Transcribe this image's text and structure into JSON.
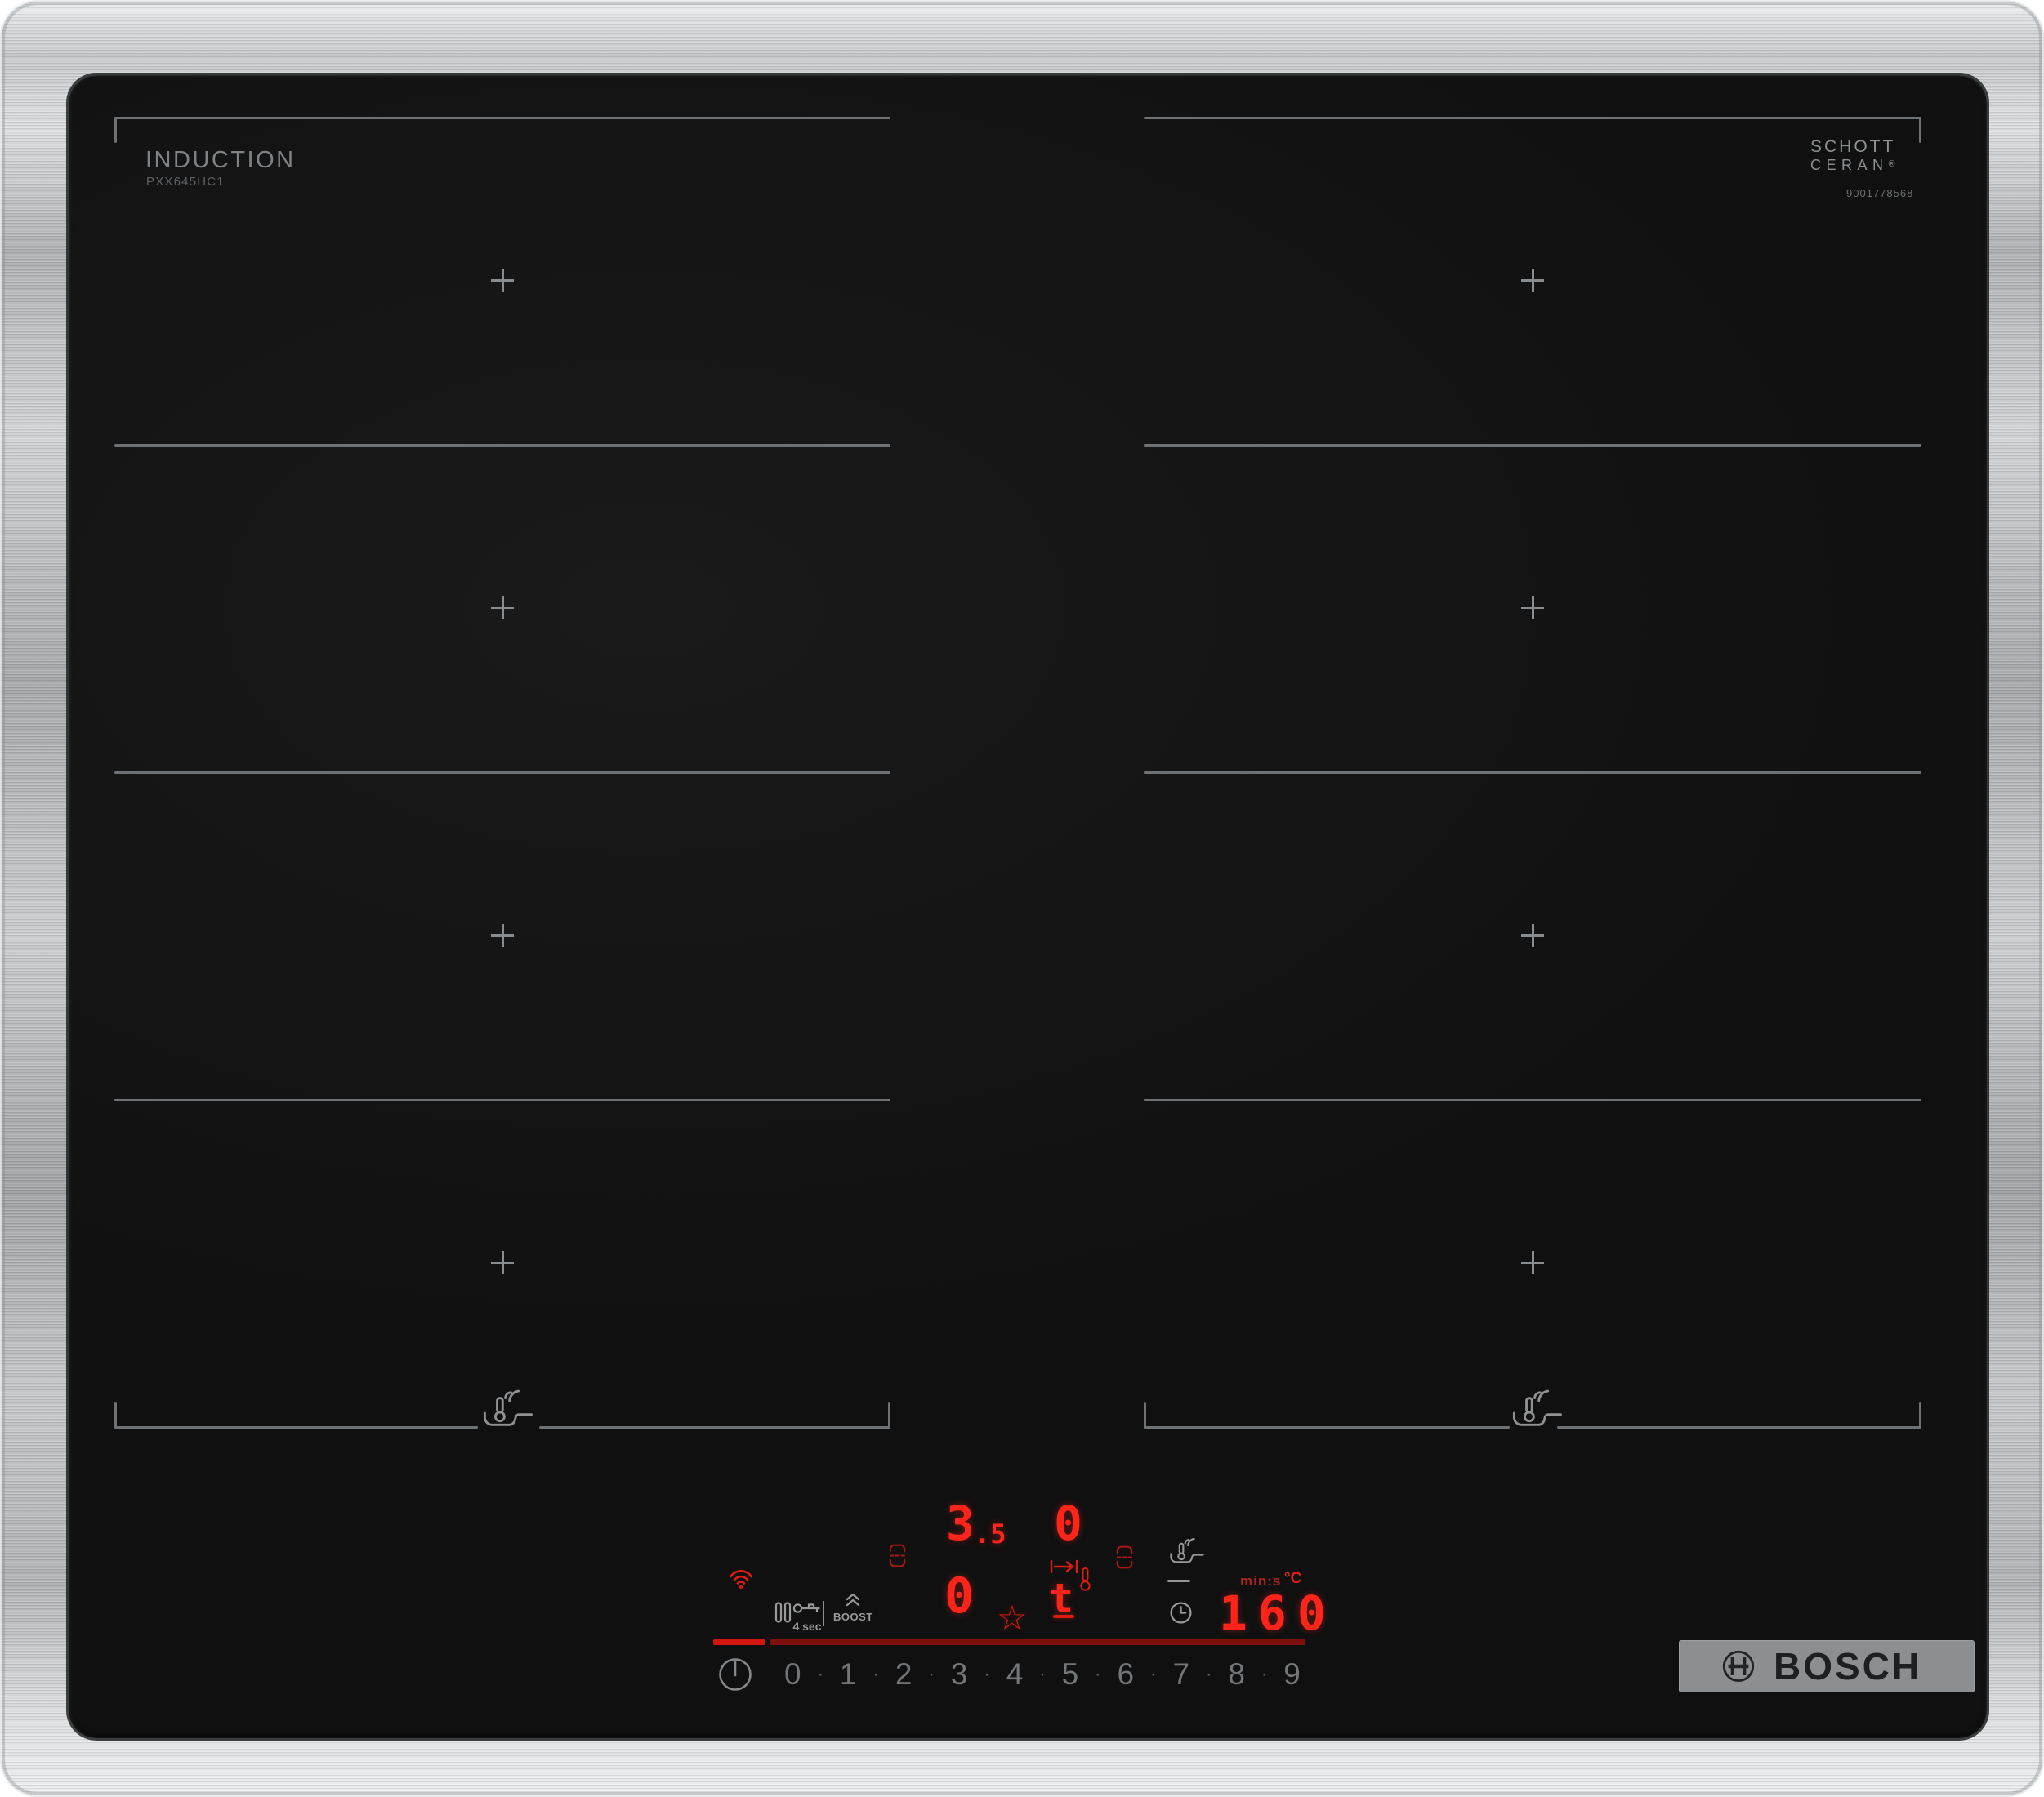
{
  "branding": {
    "surface_type_label": "INDUCTION",
    "model_number": "PXX645HC1",
    "bosch_wordmark": "BOSCH"
  },
  "glass_brand": {
    "line1": "SCHOTT",
    "line2": "CERAN",
    "registered_mark": "®",
    "serial_number": "9001778568"
  },
  "control_panel": {
    "lock_hold_label": "4 sec",
    "boost_label": "BOOST",
    "timer_unit_label": "min:s",
    "temperature_unit_label": "°C",
    "temperature_display": "160",
    "left_rear_power_display": "3",
    "left_rear_power_decimal": ".5",
    "left_front_power_display": "0",
    "right_rear_power_display": "0",
    "transfer_display": "t",
    "favorite_icon_glyph": "☆",
    "power_slider": {
      "numbers": [
        "0",
        "1",
        "2",
        "3",
        "4",
        "5",
        "6",
        "7",
        "8",
        "9"
      ],
      "dot_separator": "·"
    }
  },
  "colors": {
    "display_red": "#ff241a",
    "dim_red": "#a8251d",
    "bar_bright_red": "#d2150e",
    "bar_dim_red": "#7e100c",
    "icon_gray": "#97999b",
    "zone_line_gray": "#6f7274",
    "plate_gray": "#8c8f92"
  }
}
